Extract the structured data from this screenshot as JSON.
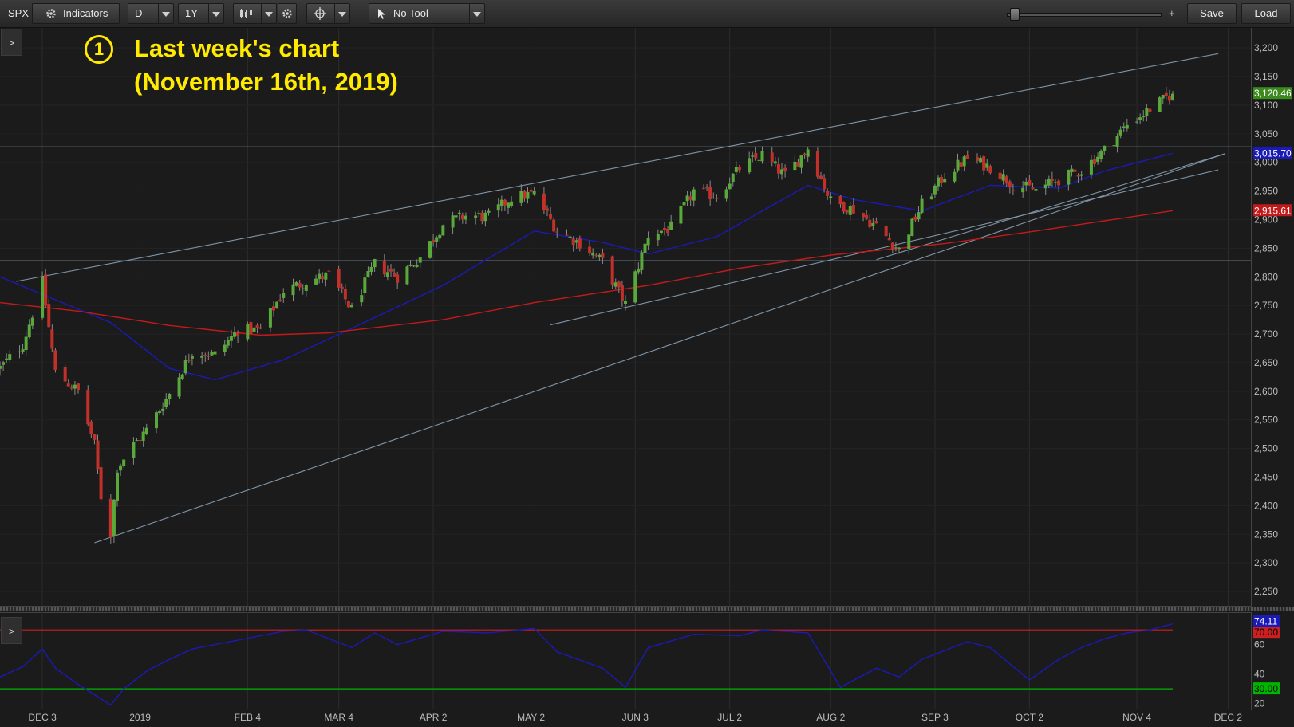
{
  "toolbar": {
    "symbol": "SPX",
    "indicators_label": "Indicators",
    "aggregation": "D",
    "timeframe": "1Y",
    "tool": "No Tool",
    "zoom_minus": "-",
    "zoom_plus": "+",
    "save_label": "Save",
    "load_label": "Load"
  },
  "annotation": {
    "marker": "1",
    "line1": "Last week's chart",
    "line2": "(November 16th, 2019)"
  },
  "expander_label": ">",
  "colors": {
    "up": "#59a83a",
    "down": "#c2302a",
    "ma_blue": "#1a1ab8",
    "ma_red": "#c21a1a",
    "trend": "#7f95a8",
    "annotation": "#ffea00",
    "oversold": "#00b400",
    "overbought": "#cc2020"
  },
  "chart_data": [
    {
      "type": "candlestick",
      "price_axis": {
        "range": [
          2225,
          3235
        ],
        "ticks": [
          "2,250",
          "2,300",
          "2,350",
          "2,400",
          "2,450",
          "2,500",
          "2,550",
          "2,600",
          "2,650",
          "2,700",
          "2,750",
          "2,800",
          "2,850",
          "2,900",
          "2,950",
          "3,000",
          "3,050",
          "3,100",
          "3,150",
          "3,200"
        ]
      },
      "date_axis": {
        "labels": [
          "DEC 3",
          "2019",
          "FEB 4",
          "MAR 4",
          "APR 2",
          "MAY 2",
          "JUN 3",
          "JUL 2",
          "AUG 2",
          "SEP 3",
          "OCT 2",
          "NOV 4",
          "DEC 2"
        ]
      },
      "price_labels": {
        "last": "3,120.46",
        "ma_fast": "3,015.70",
        "ma_slow": "2,915.61"
      },
      "series_close": [
        [
          "2018-11-20",
          2641
        ],
        [
          "2018-11-27",
          2682
        ],
        [
          "2018-12-03",
          2790
        ],
        [
          "2018-12-07",
          2633
        ],
        [
          "2018-12-14",
          2600
        ],
        [
          "2018-12-19",
          2506
        ],
        [
          "2018-12-21",
          2416
        ],
        [
          "2018-12-24",
          2351
        ],
        [
          "2018-12-26",
          2467
        ],
        [
          "2018-12-31",
          2506
        ],
        [
          "2019-01-04",
          2532
        ],
        [
          "2019-01-11",
          2596
        ],
        [
          "2019-01-18",
          2670
        ],
        [
          "2019-01-25",
          2664
        ],
        [
          "2019-02-01",
          2706
        ],
        [
          "2019-02-08",
          2707
        ],
        [
          "2019-02-15",
          2775
        ],
        [
          "2019-02-22",
          2792
        ],
        [
          "2019-03-01",
          2803
        ],
        [
          "2019-03-08",
          2743
        ],
        [
          "2019-03-15",
          2822
        ],
        [
          "2019-03-22",
          2800
        ],
        [
          "2019-03-29",
          2834
        ],
        [
          "2019-04-05",
          2892
        ],
        [
          "2019-04-12",
          2907
        ],
        [
          "2019-04-19",
          2905
        ],
        [
          "2019-04-26",
          2939
        ],
        [
          "2019-05-03",
          2945
        ],
        [
          "2019-05-10",
          2881
        ],
        [
          "2019-05-17",
          2859
        ],
        [
          "2019-05-24",
          2826
        ],
        [
          "2019-05-31",
          2752
        ],
        [
          "2019-06-07",
          2873
        ],
        [
          "2019-06-14",
          2886
        ],
        [
          "2019-06-21",
          2950
        ],
        [
          "2019-06-28",
          2941
        ],
        [
          "2019-07-05",
          2990
        ],
        [
          "2019-07-12",
          3013
        ],
        [
          "2019-07-19",
          2976
        ],
        [
          "2019-07-26",
          3025
        ],
        [
          "2019-08-02",
          2932
        ],
        [
          "2019-08-09",
          2918
        ],
        [
          "2019-08-16",
          2888
        ],
        [
          "2019-08-23",
          2847
        ],
        [
          "2019-08-30",
          2926
        ],
        [
          "2019-09-06",
          2978
        ],
        [
          "2019-09-13",
          3007
        ],
        [
          "2019-09-20",
          2992
        ],
        [
          "2019-09-27",
          2961
        ],
        [
          "2019-10-04",
          2952
        ],
        [
          "2019-10-11",
          2970
        ],
        [
          "2019-10-18",
          2986
        ],
        [
          "2019-10-25",
          3022
        ],
        [
          "2019-11-01",
          3066
        ],
        [
          "2019-11-08",
          3093
        ],
        [
          "2019-11-15",
          3120
        ]
      ],
      "moving_averages": [
        {
          "name": "fast",
          "points": [
            [
              "2018-11-20",
              2800
            ],
            [
              "2018-12-07",
              2760
            ],
            [
              "2018-12-24",
              2720
            ],
            [
              "2019-01-11",
              2640
            ],
            [
              "2019-01-25",
              2620
            ],
            [
              "2019-02-15",
              2655
            ],
            [
              "2019-03-08",
              2710
            ],
            [
              "2019-04-05",
              2785
            ],
            [
              "2019-05-03",
              2880
            ],
            [
              "2019-05-24",
              2860
            ],
            [
              "2019-06-07",
              2840
            ],
            [
              "2019-06-28",
              2870
            ],
            [
              "2019-07-26",
              2960
            ],
            [
              "2019-08-09",
              2935
            ],
            [
              "2019-08-30",
              2915
            ],
            [
              "2019-09-20",
              2960
            ],
            [
              "2019-10-11",
              2955
            ],
            [
              "2019-10-25",
              2985
            ],
            [
              "2019-11-15",
              3015.7
            ]
          ]
        },
        {
          "name": "slow",
          "points": [
            [
              "2018-11-20",
              2755
            ],
            [
              "2018-12-14",
              2740
            ],
            [
              "2019-01-11",
              2715
            ],
            [
              "2019-02-08",
              2698
            ],
            [
              "2019-03-01",
              2702
            ],
            [
              "2019-04-05",
              2725
            ],
            [
              "2019-05-03",
              2755
            ],
            [
              "2019-06-07",
              2785
            ],
            [
              "2019-07-05",
              2815
            ],
            [
              "2019-08-02",
              2838
            ],
            [
              "2019-09-06",
              2858
            ],
            [
              "2019-10-04",
              2880
            ],
            [
              "2019-11-15",
              2915.61
            ]
          ]
        }
      ],
      "horizontal_lines": [
        3027,
        2828
      ],
      "trendlines": [
        {
          "from": [
            "2018-11-25",
            2792
          ],
          "to": [
            "2019-11-29",
            3190
          ]
        },
        {
          "from": [
            "2018-12-19",
            2335
          ],
          "to": [
            "2019-12-01",
            3015
          ]
        },
        {
          "from": [
            "2019-05-08",
            2716
          ],
          "to": [
            "2019-11-29",
            2987
          ]
        },
        {
          "from": [
            "2019-08-16",
            2830
          ],
          "to": [
            "2019-12-01",
            3015
          ]
        }
      ],
      "grid": true
    },
    {
      "type": "line",
      "study": "oscillator",
      "axis": {
        "range": [
          16,
          82
        ],
        "ticks": [
          "20",
          "40",
          "60"
        ]
      },
      "levels": {
        "overbought": 70,
        "oversold": 30
      },
      "level_labels": {
        "oversold": "30.00",
        "current": "74.11",
        "overbought": "70.00"
      },
      "points": [
        [
          "2018-11-20",
          38
        ],
        [
          "2018-11-27",
          45
        ],
        [
          "2018-12-03",
          57
        ],
        [
          "2018-12-07",
          44
        ],
        [
          "2018-12-14",
          33
        ],
        [
          "2018-12-19",
          26
        ],
        [
          "2018-12-24",
          19
        ],
        [
          "2018-12-28",
          30
        ],
        [
          "2019-01-04",
          42
        ],
        [
          "2019-01-11",
          50
        ],
        [
          "2019-01-18",
          57
        ],
        [
          "2019-02-01",
          63
        ],
        [
          "2019-02-15",
          69
        ],
        [
          "2019-02-22",
          70
        ],
        [
          "2019-03-08",
          58
        ],
        [
          "2019-03-15",
          68
        ],
        [
          "2019-03-22",
          60
        ],
        [
          "2019-04-05",
          69
        ],
        [
          "2019-04-19",
          68
        ],
        [
          "2019-05-03",
          71
        ],
        [
          "2019-05-10",
          55
        ],
        [
          "2019-05-24",
          44
        ],
        [
          "2019-05-31",
          31
        ],
        [
          "2019-06-07",
          58
        ],
        [
          "2019-06-21",
          67
        ],
        [
          "2019-07-05",
          66
        ],
        [
          "2019-07-12",
          70
        ],
        [
          "2019-07-26",
          68
        ],
        [
          "2019-08-02",
          42
        ],
        [
          "2019-08-05",
          31
        ],
        [
          "2019-08-16",
          44
        ],
        [
          "2019-08-23",
          38
        ],
        [
          "2019-08-30",
          50
        ],
        [
          "2019-09-13",
          62
        ],
        [
          "2019-09-20",
          58
        ],
        [
          "2019-10-02",
          36
        ],
        [
          "2019-10-11",
          50
        ],
        [
          "2019-10-18",
          58
        ],
        [
          "2019-10-25",
          64
        ],
        [
          "2019-11-01",
          68
        ],
        [
          "2019-11-08",
          70
        ],
        [
          "2019-11-15",
          74.11
        ]
      ]
    }
  ]
}
